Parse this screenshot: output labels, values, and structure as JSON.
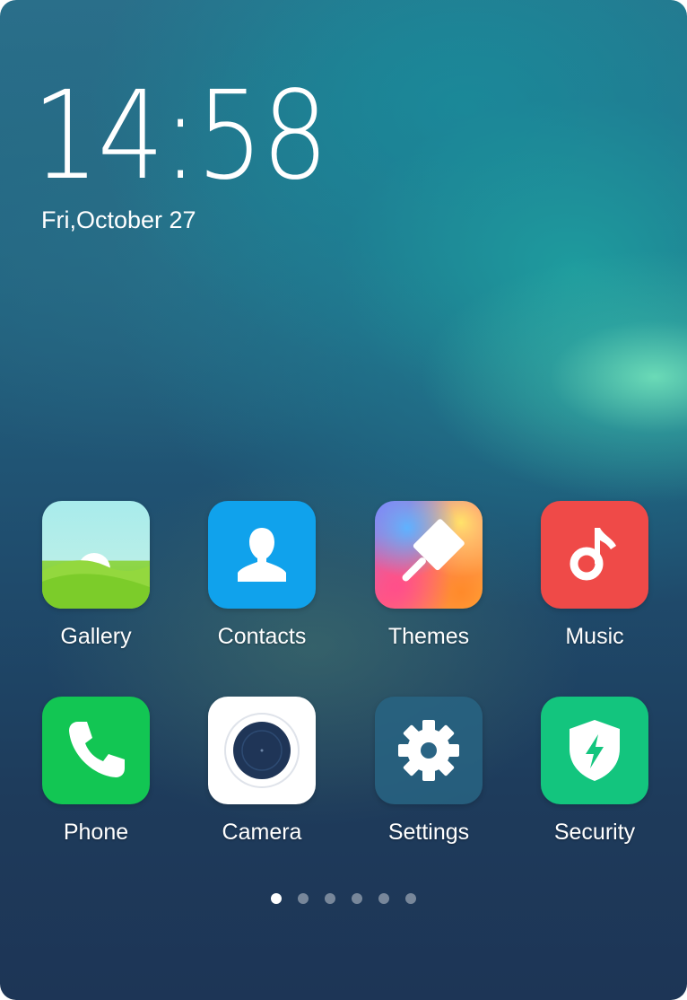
{
  "lockscreen": {
    "time": "14:58",
    "date": "Fri,October 27"
  },
  "apps": [
    {
      "label": "Gallery",
      "icon": "gallery-icon"
    },
    {
      "label": "Contacts",
      "icon": "contacts-icon"
    },
    {
      "label": "Themes",
      "icon": "themes-icon"
    },
    {
      "label": "Music",
      "icon": "music-icon"
    },
    {
      "label": "Phone",
      "icon": "phone-icon"
    },
    {
      "label": "Camera",
      "icon": "camera-icon"
    },
    {
      "label": "Settings",
      "icon": "settings-icon"
    },
    {
      "label": "Security",
      "icon": "security-icon"
    }
  ],
  "pager": {
    "pages": 6,
    "current": 1
  },
  "colors": {
    "contacts": "#10a2ec",
    "music": "#ef4a48",
    "phone": "#12c653",
    "security": "#13c57e"
  }
}
